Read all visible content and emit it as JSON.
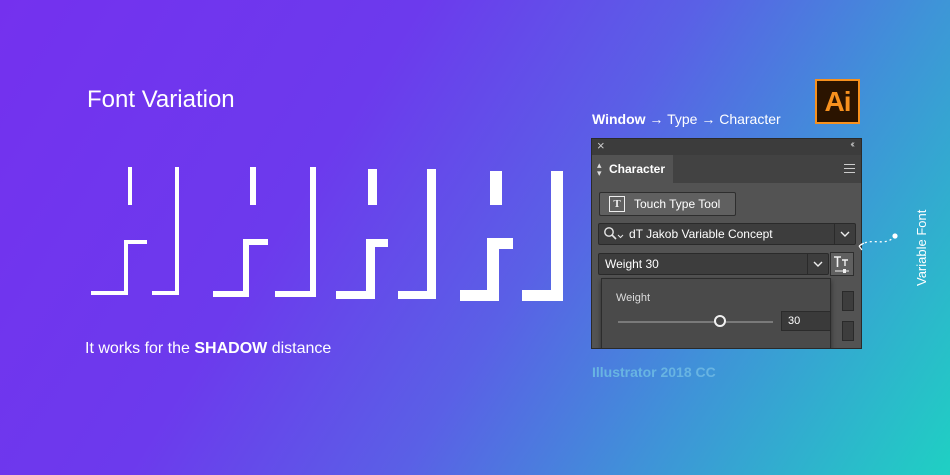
{
  "hero": {
    "title": "Font Variation",
    "tagline_prefix": "It works for the",
    "tagline_emphasis": "SHADOW",
    "tagline_suffix": "distance"
  },
  "breadcrumb": {
    "window": "Window",
    "arrow": "→",
    "type": "Type",
    "character": "Character"
  },
  "app": {
    "logo_text": "Ai",
    "caption": "Illustrator 2018 CC",
    "annotation": "Variable Font"
  },
  "panel": {
    "close_icon": "×",
    "collapse_icon": "‹‹",
    "tab_label": "Character",
    "touch_type_label": "Touch Type Tool",
    "font_family": "dT Jakob Variable Concept",
    "font_style": "Weight 30",
    "popup": {
      "axis_label": "Weight",
      "axis_value": "30",
      "slider_fraction": 0.66
    }
  },
  "colors": {
    "gradient_start": "#7431ee",
    "gradient_end": "#1fd0c3",
    "panel_bg": "#535353",
    "logo_accent": "#f7911e",
    "caption": "#68b4e2"
  },
  "icons": [
    "close-icon",
    "collapse-icon",
    "chevron-icon",
    "panel-menu-icon",
    "touch-type-icon",
    "search-icon",
    "chevron-down-icon",
    "variable-font-icon"
  ]
}
